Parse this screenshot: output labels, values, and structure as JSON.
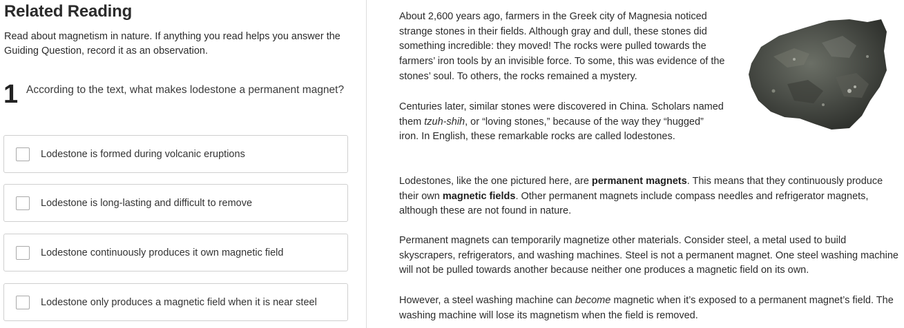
{
  "left": {
    "title": "Related Reading",
    "intro": "Read about magnetism in nature. If anything you read helps you answer the Guiding Question, record it as an observation.",
    "question": {
      "number": "1",
      "text": "According to the text, what makes lodestone a permanent magnet?"
    },
    "choices": [
      {
        "label": "Lodestone is formed during volcanic eruptions",
        "checked": false
      },
      {
        "label": "Lodestone is long-lasting and difficult to remove",
        "checked": false
      },
      {
        "label": "Lodestone continuously produces it own magnetic field",
        "checked": false
      },
      {
        "label": "Lodestone only produces a magnetic field when it is near steel",
        "checked": false
      }
    ]
  },
  "reading": {
    "p1": "About 2,600 years ago, farmers in the Greek city of Magnesia noticed strange stones in their fields. Although gray and dull, these stones did something incredible: they moved! The rocks were pulled towards the farmers’ iron tools by an invisible force. To some, this was evidence of the stones’ soul. To others, the rocks remained a mystery.",
    "p2": {
      "a": "Centuries later, similar stones were discovered in China. Scholars named them ",
      "italic": "tzuh-shih",
      "b": ", or “loving stones,” because of the way they “hugged” iron. In English, these remarkable rocks are called lodestones."
    },
    "p3": {
      "a": "Lodestones, like the one pictured here, are ",
      "bold1": "permanent magnets",
      "b": ". This means that they continuously produce their own ",
      "bold2": "magnetic fields",
      "c": ". Other permanent magnets include compass needles and refrigerator magnets, although these are not found in nature."
    },
    "p4": "Permanent magnets can temporarily magnetize other materials. Consider steel, a metal used to build skyscrapers, refrigerators, and washing machines. Steel is not a permanent magnet. One steel washing machine will not be pulled towards another because neither one produces a magnetic field on its own.",
    "p5": {
      "a": "However, a steel washing machine can ",
      "italic": "become",
      "b": " magnetic when it’s exposed to a permanent magnet’s field. The washing machine will lose its magnetism when the field is removed."
    },
    "image": "lodestone-rock"
  }
}
